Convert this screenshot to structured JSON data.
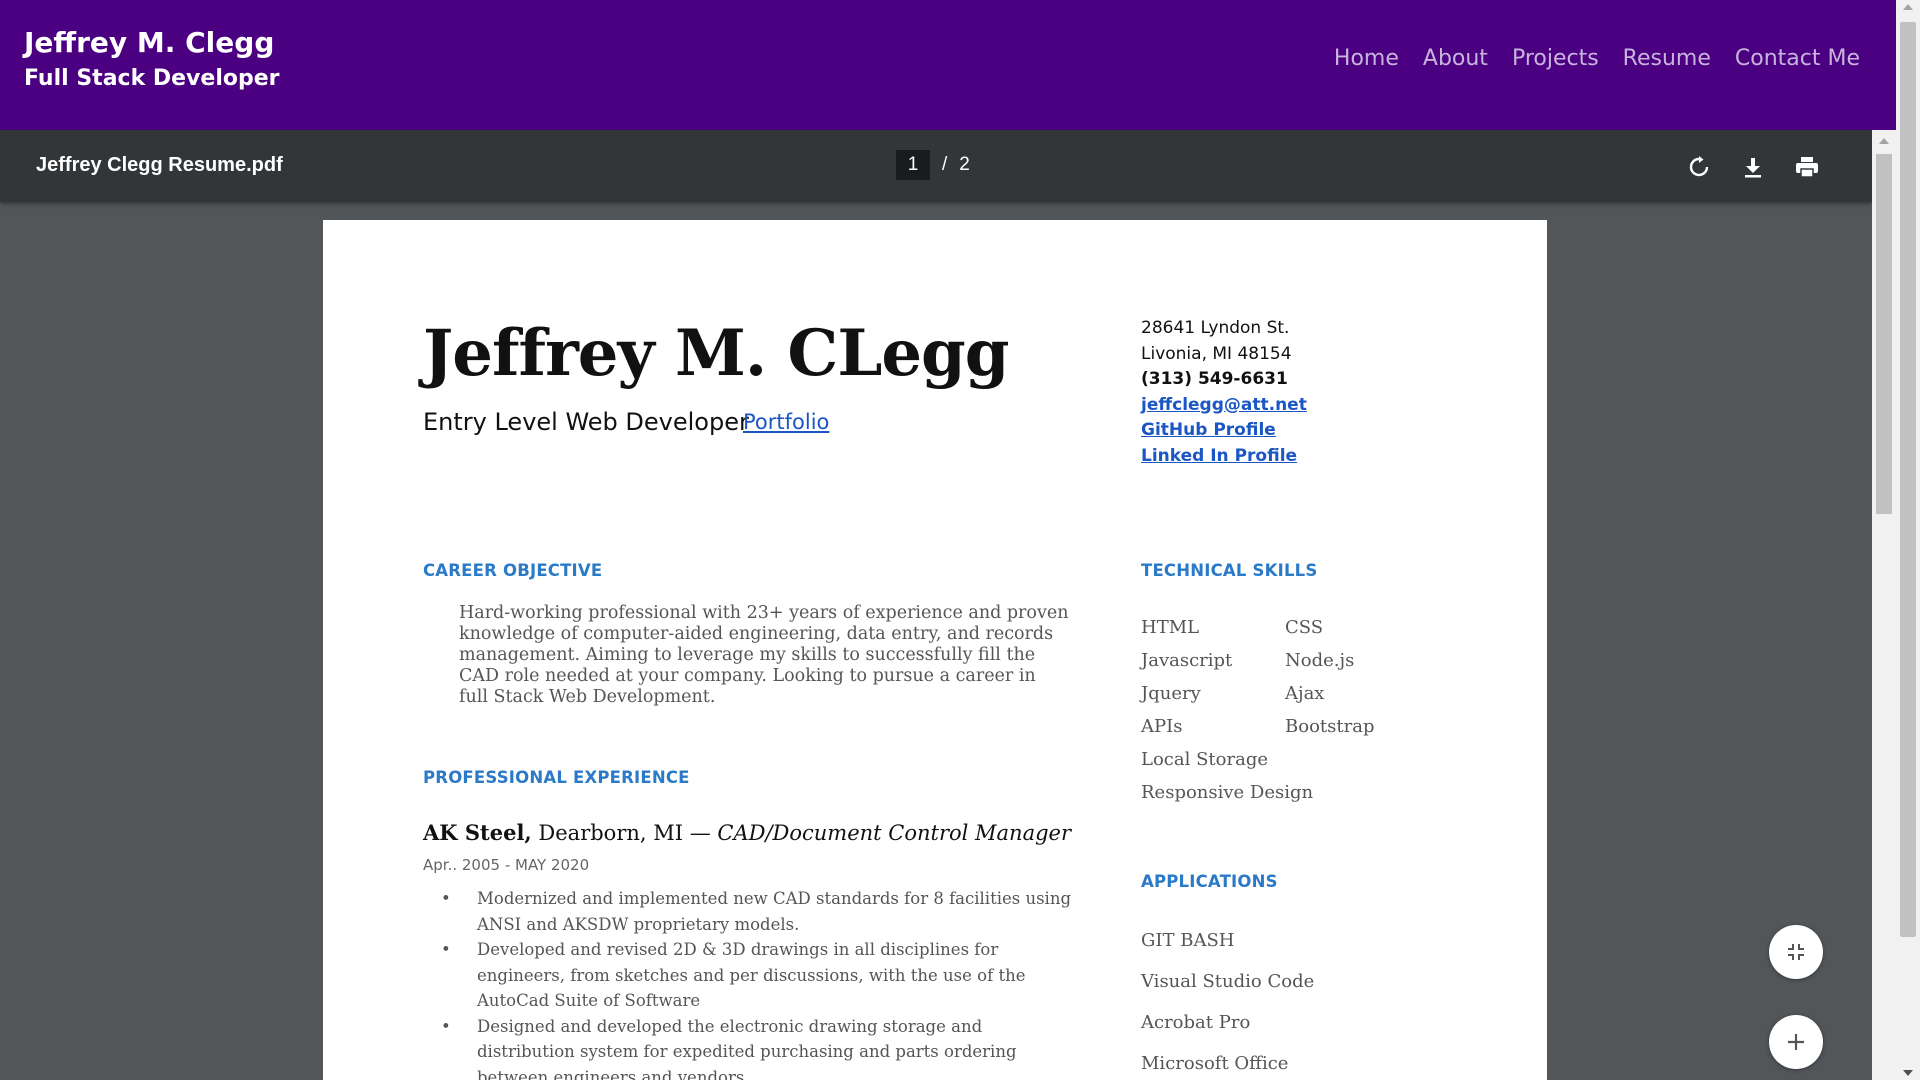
{
  "site": {
    "name": "Jeffrey M. Clegg",
    "role": "Full Stack Developer",
    "nav": [
      "Home",
      "About",
      "Projects",
      "Resume",
      "Contact Me"
    ],
    "colors": {
      "header_bg": "#4b0082",
      "nav_text": "#c7b3dc"
    }
  },
  "pdf": {
    "title": "Jeffrey Clegg Resume.pdf",
    "current_page": "1",
    "page_separator": "/",
    "total_pages": "2",
    "toolbar_icons": [
      "rotate-icon",
      "download-icon",
      "print-icon"
    ]
  },
  "resume": {
    "name": "Jeffrey M. CLegg",
    "role": "Entry Level Web Developer",
    "portfolio_link": "Portfolio",
    "contact": {
      "street": "28641 Lyndon St.",
      "city": "Livonia, MI 48154",
      "phone": "(313) 549-6631",
      "email": "jeffclegg@att.net",
      "github": "GitHub Profile",
      "linkedin": "Linked In Profile"
    },
    "career_objective": {
      "heading": "CAREER OBJECTIVE",
      "text": "Hard-working professional with 23+ years of experience and proven knowledge of computer-aided engineering, data entry, and records management. Aiming to leverage my skills to successfully fill the CAD role needed at your company. Looking to pursue a career in full Stack Web Development."
    },
    "experience": {
      "heading": "PROFESSIONAL EXPERIENCE",
      "company": "AK Steel,",
      "location": " Dearborn, MI — ",
      "position": "CAD/Document Control Manager",
      "dates": "Apr..  2005  - MAY 2020",
      "bullets": [
        "Modernized and implemented new CAD standards for 8 facilities using ANSI and AKSDW proprietary models.",
        "Developed and revised 2D & 3D drawings in all disciplines for engineers, from sketches and per discussions, with the use of the AutoCad Suite of Software",
        "Designed and developed the electronic drawing storage and distribution system for expedited purchasing and parts ordering between engineers and vendors."
      ]
    },
    "technical_skills": {
      "heading": "TECHNICAL SKILLS",
      "items": [
        "HTML",
        "CSS",
        "Javascript",
        "Node.js",
        "Jquery",
        "Ajax",
        "APIs",
        "Bootstrap",
        "Local Storage",
        "",
        "Responsive Design",
        ""
      ]
    },
    "applications": {
      "heading": "APPLICATIONS",
      "items": [
        "GIT BASH",
        "Visual Studio Code",
        "Acrobat Pro",
        "Microsoft Office"
      ]
    }
  }
}
